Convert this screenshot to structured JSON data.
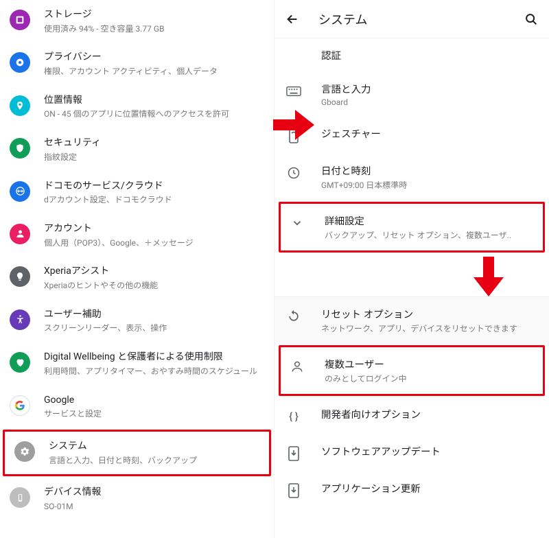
{
  "left": {
    "items": [
      {
        "title": "ストレージ",
        "sub": "使用済み 94% - 空き容量 3.77 GB"
      },
      {
        "title": "プライバシー",
        "sub": "権限、アカウント アクティビティ、個人データ"
      },
      {
        "title": "位置情報",
        "sub": "ON - 45 個のアプリに位置情報へのアクセスを許可"
      },
      {
        "title": "セキュリティ",
        "sub": "指紋設定"
      },
      {
        "title": "ドコモのサービス/クラウド",
        "sub": "dアカウント設定、ドコモクラウド"
      },
      {
        "title": "アカウント",
        "sub": "個人用（POP3）、Google、＋メッセージ"
      },
      {
        "title": "Xperiaアシスト",
        "sub": "Xperiaのヒントやその他の機能"
      },
      {
        "title": "ユーザー補助",
        "sub": "スクリーンリーダー、表示、操作"
      },
      {
        "title": "Digital Wellbeing と保護者による使用制限",
        "sub": "利用時間、アプリタイマー、おやすみ時間のスケジュール"
      },
      {
        "title": "Google",
        "sub": "サービスと設定"
      },
      {
        "title": "システム",
        "sub": "言語と入力、日付と時刻、バックアップ"
      },
      {
        "title": "デバイス情報",
        "sub": "SO-01M"
      }
    ]
  },
  "right": {
    "header_title": "システム",
    "top": [
      {
        "title": "認証",
        "sub": "",
        "noicon": true
      },
      {
        "title": "言語と入力",
        "sub": "Gboard"
      },
      {
        "title": "ジェスチャー",
        "sub": ""
      },
      {
        "title": "日付と時刻",
        "sub": "GMT+09:00 日本標準時"
      },
      {
        "title": "詳細設定",
        "sub": "バックアップ、リセット オプション、複数ユーザ.."
      }
    ],
    "bottom": [
      {
        "title": "リセット オプション",
        "sub": "ネットワーク、アプリ、デバイスをリセットできます"
      },
      {
        "title": "複数ユーザー",
        "sub": "のみとしてログイン中"
      },
      {
        "title": "開発者向けオプション",
        "sub": ""
      },
      {
        "title": "ソフトウェアアップデート",
        "sub": ""
      },
      {
        "title": "アプリケーション更新",
        "sub": ""
      }
    ]
  },
  "colors": {
    "highlight": "#e60012"
  }
}
